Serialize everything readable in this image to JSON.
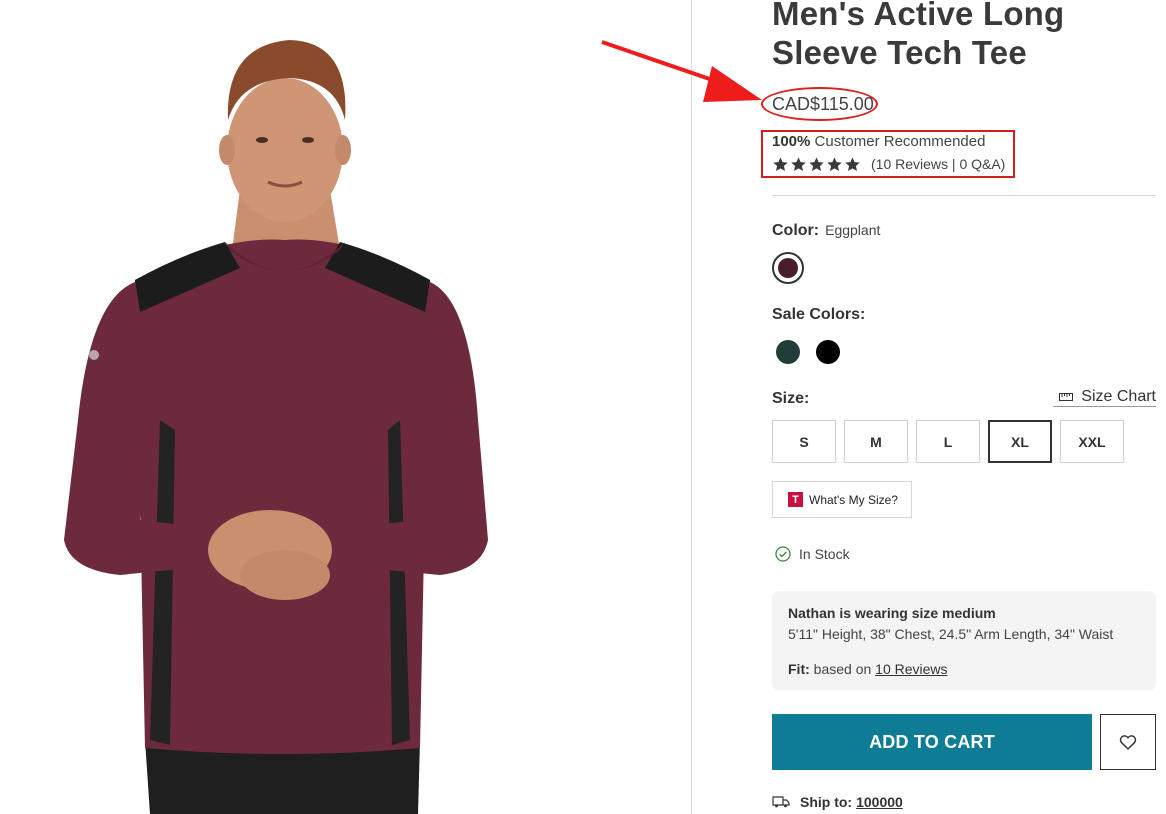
{
  "product": {
    "title": "Men's Active Long Sleeve Tech Tee",
    "price": "CAD$115.00"
  },
  "rating": {
    "recommended_pct": "100%",
    "recommended_text": "Customer Recommended",
    "stars": 5,
    "reviews_text": "(10 Reviews | 0 Q&A)"
  },
  "color": {
    "label": "Color:",
    "selected": "Eggplant",
    "selected_hex": "#4a1d2c"
  },
  "sale_colors": {
    "label": "Sale Colors:",
    "swatches": [
      "#203d3a",
      "#000000"
    ]
  },
  "size": {
    "label": "Size:",
    "chart_label": "Size Chart",
    "options": [
      "S",
      "M",
      "L",
      "XL",
      "XXL"
    ],
    "selected": "XL",
    "whats_my_size": "What's My Size?",
    "whats_my_size_badge": "T"
  },
  "stock": {
    "text": "In Stock"
  },
  "model": {
    "title": "Nathan is wearing size medium",
    "measurements": "5'11\" Height, 38\" Chest, 24.5\" Arm Length, 34\" Waist",
    "fit_label": "Fit:",
    "fit_text": "based on",
    "fit_link": "10 Reviews"
  },
  "actions": {
    "add_to_cart": "ADD TO CART"
  },
  "shipping": {
    "label": "Ship to:",
    "zip": "100000"
  },
  "colors": {
    "accent": "#0e7c94",
    "annotation_red": "#e02020"
  }
}
